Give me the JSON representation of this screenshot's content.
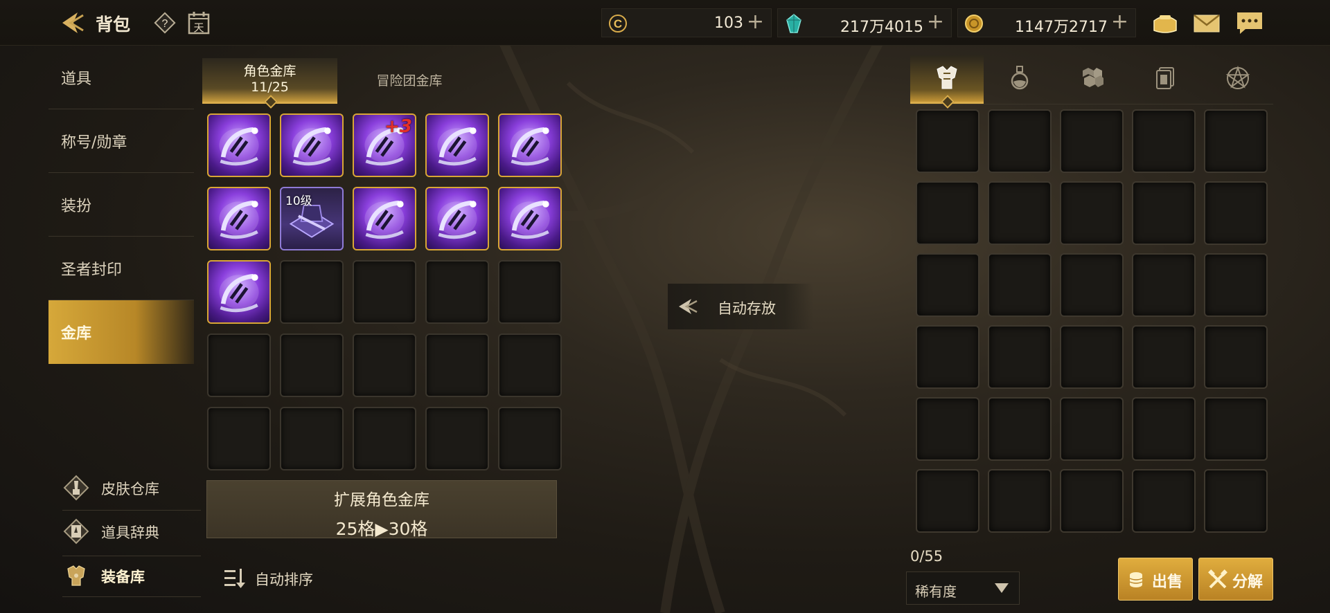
{
  "header": {
    "title": "背包",
    "calendar_label": "天"
  },
  "currencies": [
    {
      "icon": "c-coin-icon",
      "value": "103"
    },
    {
      "icon": "green-crystal-icon",
      "value": "217万4015"
    },
    {
      "icon": "gold-coin-icon",
      "value": "1147万2717"
    }
  ],
  "sidebar": {
    "items": [
      {
        "label": "道具",
        "active": false
      },
      {
        "label": "称号/勋章",
        "active": false
      },
      {
        "label": "装扮",
        "active": false
      },
      {
        "label": "圣者封印",
        "active": false
      },
      {
        "label": "金库",
        "active": true
      }
    ],
    "sub_items": [
      {
        "label": "皮肤仓库",
        "icon": "brush-icon"
      },
      {
        "label": "道具辞典",
        "icon": "book-icon"
      },
      {
        "label": "装备库",
        "icon": "armor-icon"
      }
    ]
  },
  "vault": {
    "tabs": [
      {
        "label": "角色金库",
        "count": "11/25",
        "active": true
      },
      {
        "label": "冒险团金库",
        "active": false
      }
    ],
    "slots": [
      {
        "item": "purple-gear-item"
      },
      {
        "item": "purple-gear-item"
      },
      {
        "item": "purple-gear-item",
        "badge": "+3"
      },
      {
        "item": "purple-gear-item"
      },
      {
        "item": "purple-gear-item"
      },
      {
        "item": "purple-gear-item"
      },
      {
        "item": "level-box-item",
        "badge": "10级"
      },
      {
        "item": "purple-gear-item"
      },
      {
        "item": "purple-gear-item"
      },
      {
        "item": "purple-gear-item"
      },
      {
        "item": "purple-gear-item"
      }
    ],
    "total_slots": 25,
    "expand": {
      "title": "扩展角色金库",
      "detail": "25格▶30格"
    },
    "autosort_label": "自动排序"
  },
  "autostore_label": "自动存放",
  "inventory": {
    "tabs": [
      "armor-icon",
      "potion-icon",
      "material-icon",
      "card-icon",
      "pentagram-icon"
    ],
    "active_tab": 0,
    "count": "0/55",
    "rarity_label": "稀有度",
    "sell_label": "出售",
    "disassemble_label": "分解"
  },
  "colors": {
    "accent": "#d9ac4b",
    "item_border": "#d9a636",
    "plus_badge": "#e3302a"
  }
}
